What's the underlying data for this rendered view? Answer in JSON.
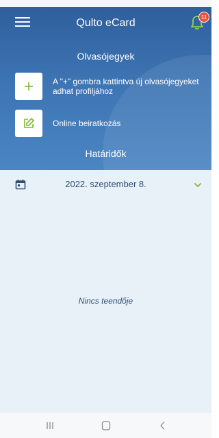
{
  "app": {
    "title": "Qulto eCard",
    "notification_count": "11"
  },
  "cards_section": {
    "title": "Olvasójegyek",
    "add_card_hint": "A \"+\" gombra kattintva új olvasójegyeket adhat profiljához",
    "online_enrollment_label": "Online beiratkozás"
  },
  "deadlines_section": {
    "title": "Határidők",
    "date": "2022. szeptember 8.",
    "empty_message": "Nincs teendője"
  },
  "colors": {
    "header_blue": "#3d74b3",
    "accent_green": "#7fb52f",
    "content_bg": "#e8f0f8",
    "badge_red": "#e6533c"
  },
  "icons": {
    "menu": "hamburger-menu-icon",
    "notifications": "bell-icon",
    "add_card": "plus-icon",
    "enrollment": "edit-icon",
    "date": "calendar-icon",
    "expand": "chevron-down-icon",
    "nav_recent": "recent-apps-icon",
    "nav_home": "home-icon",
    "nav_back": "back-icon"
  }
}
